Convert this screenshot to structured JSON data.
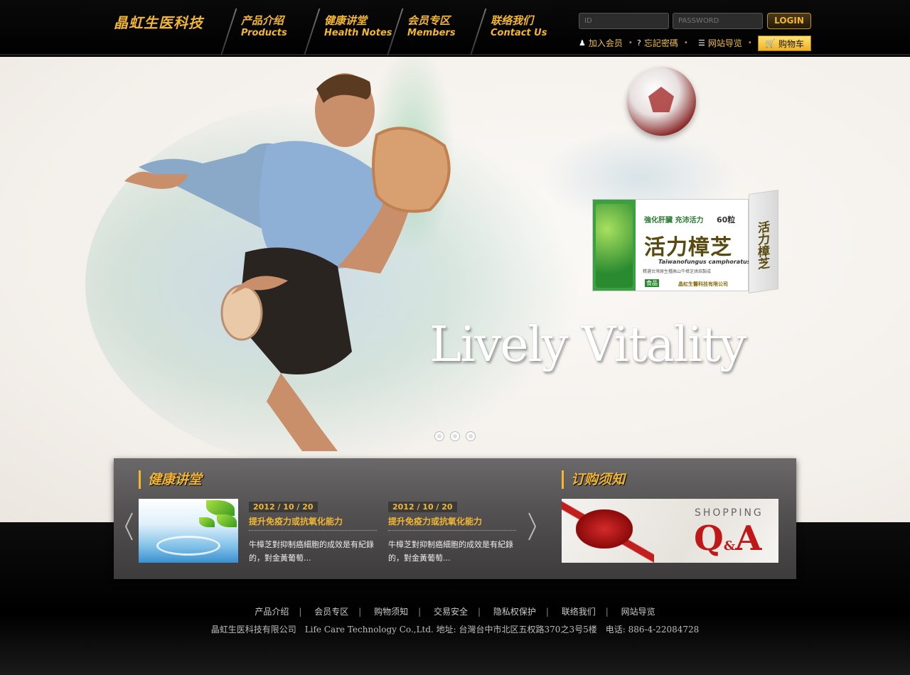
{
  "header": {
    "logo": "晶虹生医科技",
    "nav": [
      {
        "cn": "产品介绍",
        "en": "Products"
      },
      {
        "cn": "健康讲堂",
        "en": "Health Notes"
      },
      {
        "cn": "会员专区",
        "en": "Members"
      },
      {
        "cn": "联络我们",
        "en": "Contact Us"
      }
    ],
    "login": {
      "id_placeholder": "ID",
      "password_placeholder": "PASSWORD",
      "button": "LOGIN"
    },
    "utility": {
      "join": "加入会员",
      "forgot": "忘記密碼",
      "sitemap": "网站导览",
      "cart": "购物车"
    }
  },
  "hero": {
    "tagline": "Lively Vitality",
    "product": {
      "tag": "強化肝臟 充沛活力",
      "count": "60粒",
      "title": "活力樟芝",
      "latin": "Taiwanofungus camphoratus",
      "desc": "精選台灣原生種高山牛樟芝烘焙製成",
      "food": "食品",
      "brand": "晶虹生醫科技有限公司"
    },
    "slides": 3
  },
  "news": {
    "heading": "健康讲堂",
    "items": [
      {
        "date": "2012 / 10 / 20",
        "title": "提升免疫力或抗氧化能力",
        "body": "牛樟芝對抑制癌細胞的成效是有紀錄的，對金黃葡萄..."
      },
      {
        "date": "2012 / 10 / 20",
        "title": "提升免疫力或抗氧化能力",
        "body": "牛樟芝對抑制癌細胞的成效是有紀錄的，對金黃葡萄..."
      }
    ]
  },
  "order": {
    "heading": "订购须知",
    "banner_word": "SHOPPING",
    "banner_q": "Q",
    "banner_amp": "&",
    "banner_a": "A"
  },
  "footer": {
    "links": [
      "产品介绍",
      "会员专区",
      "购物须知",
      "交易安全",
      "隐私权保护",
      "联络我们",
      "网站导览"
    ],
    "separator": "|",
    "info": "晶虹生医科技有限公司　Life Care Technology Co.,Ltd. 地址: 台灣台中市北区五权路370之3号5楼　电话: 886-4-22084728"
  },
  "colors": {
    "accent": "#f2b632",
    "header_bg": "#000000",
    "panel_bg": "#504e4e",
    "qa_red": "#c01818"
  }
}
